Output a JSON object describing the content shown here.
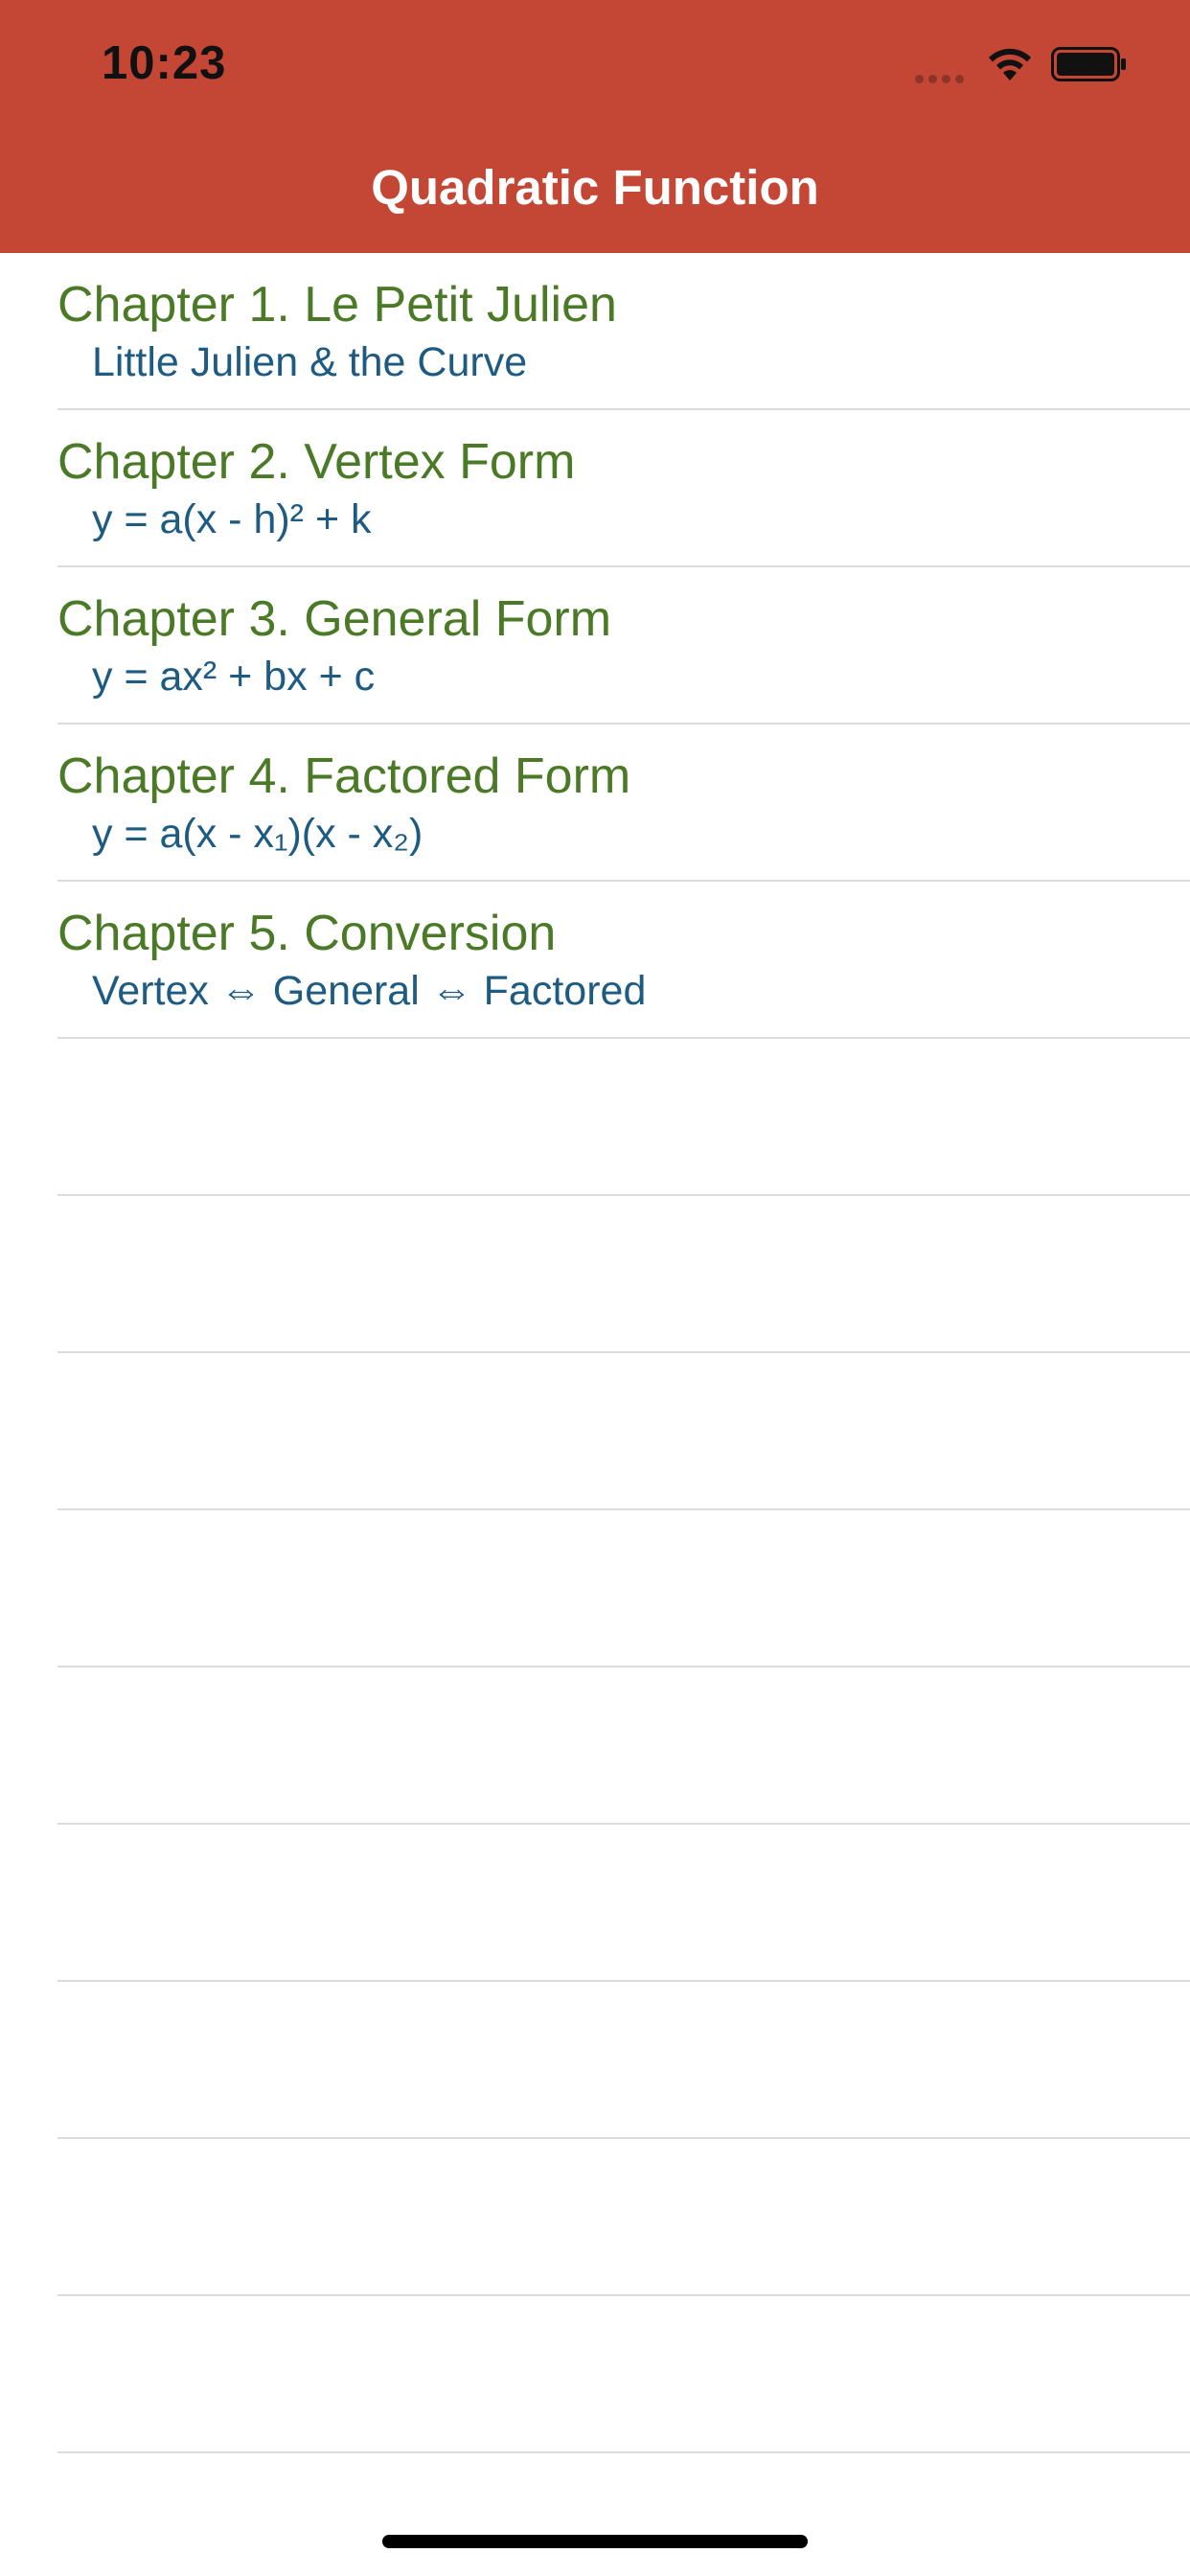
{
  "status_bar": {
    "time": "10:23"
  },
  "nav": {
    "title": "Quadratic Function"
  },
  "chapters": [
    {
      "title": "Chapter 1. Le Petit Julien",
      "subtitle": "Little Julien & the Curve"
    },
    {
      "title": "Chapter 2. Vertex Form",
      "subtitle": "y = a(x - h)² + k"
    },
    {
      "title": "Chapter 3. General Form",
      "subtitle": "y = ax² + bx + c"
    },
    {
      "title": "Chapter 4. Factored Form",
      "subtitle": "y = a(x - x₁)(x - x₂)"
    },
    {
      "title": "Chapter 5. Conversion",
      "subtitle": "Vertex ⇔ General ⇔ Factored"
    }
  ],
  "empty_rows": 9,
  "colors": {
    "header_bg": "#c44635",
    "chapter_title": "#4a7a25",
    "chapter_subtitle": "#1e5b82",
    "separator": "#dcdcdc"
  },
  "icons": [
    "signal-icon",
    "wifi-icon",
    "battery-icon"
  ]
}
